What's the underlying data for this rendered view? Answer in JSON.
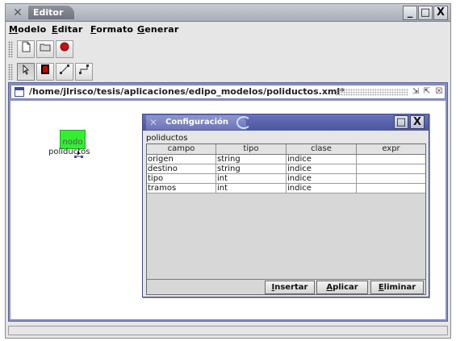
{
  "window": {
    "title": "Editor",
    "controls": {
      "minimize": "_",
      "maximize": "□",
      "close": "X"
    }
  },
  "menu": [
    {
      "label": "Modelo",
      "mnemonic": "M",
      "rest": "odelo"
    },
    {
      "label": "Editar",
      "mnemonic": "E",
      "rest": "ditar"
    },
    {
      "label": "Formato",
      "mnemonic": "F",
      "rest": "ormato"
    },
    {
      "label": "Generar",
      "mnemonic": "G",
      "rest": "enerar"
    }
  ],
  "toolbar1": {
    "icons": [
      "new-document-icon",
      "open-icon",
      "record-icon"
    ]
  },
  "toolbar2": {
    "icons": [
      "pointer-icon",
      "stop-icon",
      "connector-icon",
      "bend-connector-icon"
    ]
  },
  "document": {
    "title": "/home/jlrisco/tesis/aplicaciones/edipo_modelos/poliductos.xml*",
    "controls": {
      "iconify": "⇲",
      "maximize": "⇱",
      "close": "☒"
    }
  },
  "node": {
    "label": "nodo",
    "caption": "poliductos"
  },
  "dialog": {
    "title": "Configuración",
    "name": "poliductos",
    "controls": {
      "maximize": "□",
      "close": "X"
    },
    "columns": [
      "campo",
      "tipo",
      "clase",
      "expr"
    ],
    "rows": [
      {
        "campo": "origen",
        "tipo": "string",
        "clase": "indice",
        "expr": ""
      },
      {
        "campo": "destino",
        "tipo": "string",
        "clase": "indice",
        "expr": ""
      },
      {
        "campo": "tipo",
        "tipo": "int",
        "clase": "indice",
        "expr": ""
      },
      {
        "campo": "tramos",
        "tipo": "int",
        "clase": "indice",
        "expr": ""
      }
    ],
    "buttons": {
      "insertar": {
        "mnemonic": "I",
        "rest": "nsertar"
      },
      "aplicar": {
        "mnemonic": "A",
        "rest": "plicar"
      },
      "eliminar": {
        "mnemonic": "E",
        "rest": "liminar"
      }
    }
  },
  "colors": {
    "node_fill": "#33ee33",
    "dialog_title": "#4c56a0",
    "doc_frame": "#8890c4"
  }
}
